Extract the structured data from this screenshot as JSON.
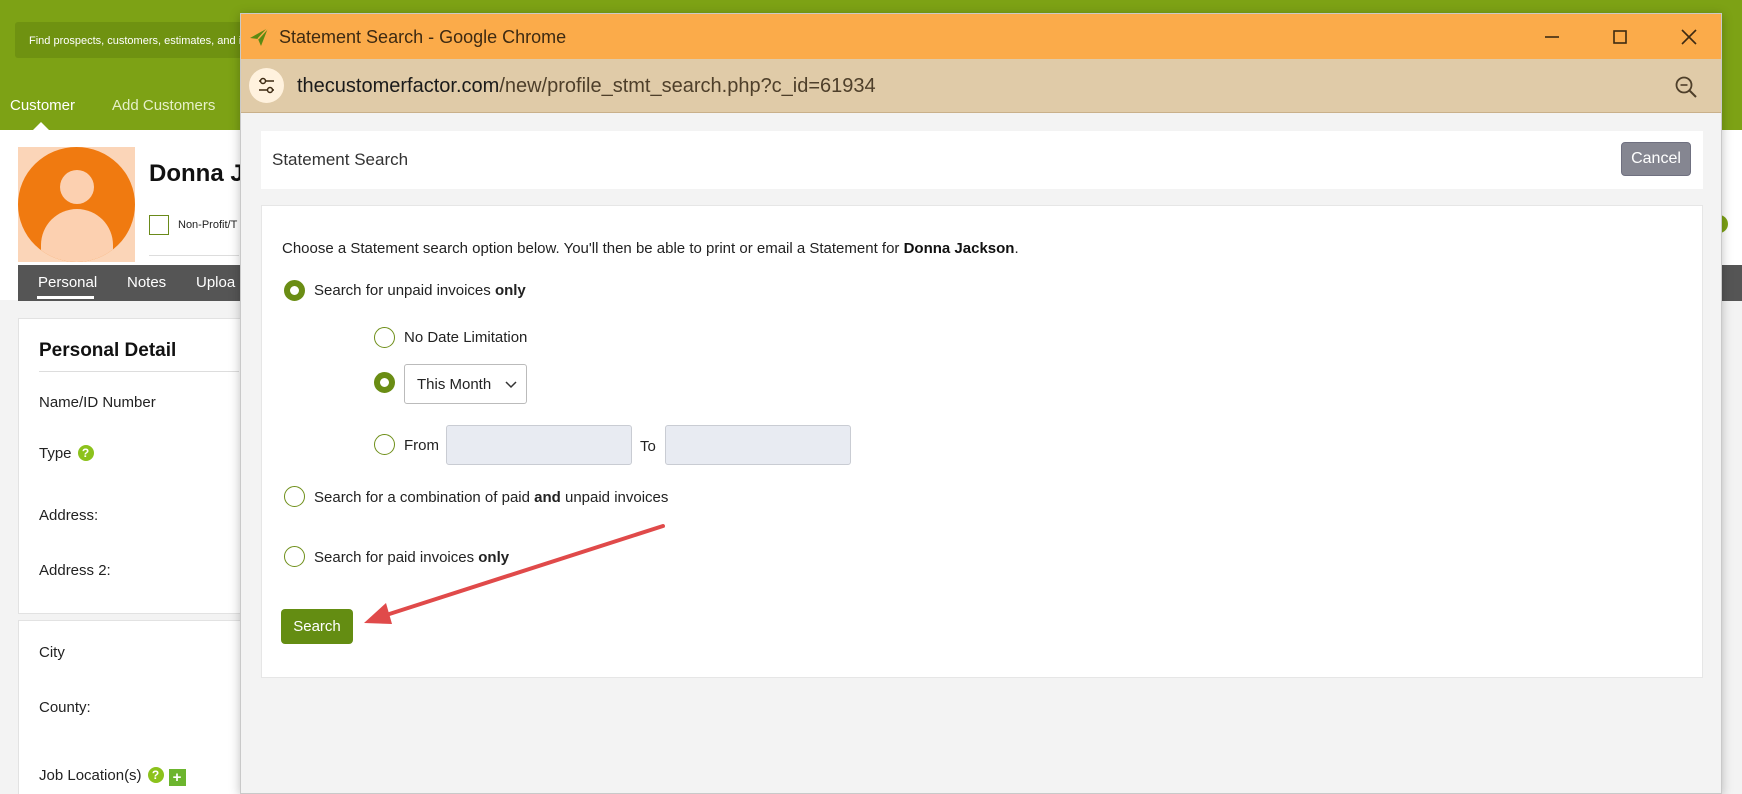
{
  "background": {
    "search_hint": "Find prospects, customers, estimates, and inv",
    "nav": {
      "customer": "Customer",
      "add_customers": "Add Customers"
    },
    "profile": {
      "name": "Donna Ja",
      "checkbox_label": "Non-Profit/T"
    },
    "subtabs": {
      "personal": "Personal",
      "notes": "Notes",
      "uploads": "Uploa"
    },
    "card": {
      "title": "Personal Detail",
      "name_id": "Name/ID Number",
      "type": "Type",
      "address": "Address:",
      "address2": "Address 2:",
      "city": "City",
      "county": "County:",
      "job_locations": "Job Location(s)"
    }
  },
  "window": {
    "title": "Statement Search - Google Chrome",
    "url_domain": "thecustomerfactor.com",
    "url_path": "/new/profile_stmt_search.php?c_id=61934"
  },
  "modal": {
    "header_title": "Statement Search",
    "cancel_label": "Cancel",
    "intro_prefix": "Choose a Statement search option below. You'll then be able to print or email a Statement for ",
    "customer_name": "Donna Jackson",
    "intro_suffix": ".",
    "option_unpaid": {
      "text": "Search for unpaid invoices ",
      "bold": "only",
      "checked": true
    },
    "sub_no_date": {
      "text": "No Date Limitation",
      "checked": false
    },
    "sub_period": {
      "checked": true,
      "selected": "This Month"
    },
    "sub_range": {
      "from": "From",
      "to": "To",
      "checked": false,
      "from_value": "",
      "to_value": ""
    },
    "option_combo": {
      "pre": "Search for a combination of paid ",
      "bold": "and",
      "post": " unpaid invoices",
      "checked": false
    },
    "option_paid": {
      "text": "Search for paid invoices ",
      "bold": "only",
      "checked": false
    },
    "search_label": "Search"
  },
  "colors": {
    "brand_green": "#7da215",
    "title_bar": "#fbab4a",
    "address_bar": "#e0cba8",
    "search_button": "#648d12",
    "cancel_button": "#858691",
    "annotation_arrow": "#e04a4a"
  }
}
